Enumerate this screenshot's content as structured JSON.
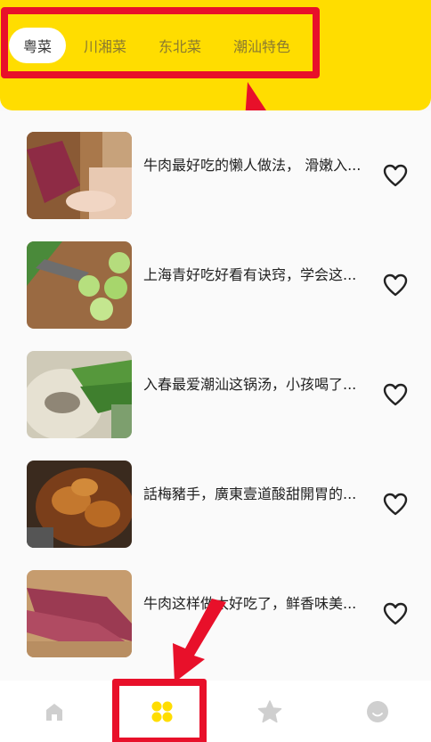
{
  "tabs": [
    {
      "label": "粤菜",
      "active": true
    },
    {
      "label": "川湘菜",
      "active": false
    },
    {
      "label": "东北菜",
      "active": false
    },
    {
      "label": "潮汕特色",
      "active": false
    }
  ],
  "recipes": [
    {
      "title": "牛肉最好吃的懒人做法， 滑嫩入..."
    },
    {
      "title": "上海青好吃好看有诀窍，学会这..."
    },
    {
      "title": "入春最爱潮汕这锅汤，小孩喝了..."
    },
    {
      "title": "話梅豬手，廣東壹道酸甜開胃的..."
    },
    {
      "title": "牛肉这样做太好吃了，鲜香味美..."
    }
  ],
  "bottom_nav": [
    {
      "icon": "home-icon",
      "active": false
    },
    {
      "icon": "category-grid-icon",
      "active": true
    },
    {
      "icon": "star-icon",
      "active": false
    },
    {
      "icon": "profile-icon",
      "active": false
    }
  ],
  "colors": {
    "accent": "#ffdd00",
    "highlight": "#e8102a",
    "nav_inactive": "#c8c8c8"
  }
}
